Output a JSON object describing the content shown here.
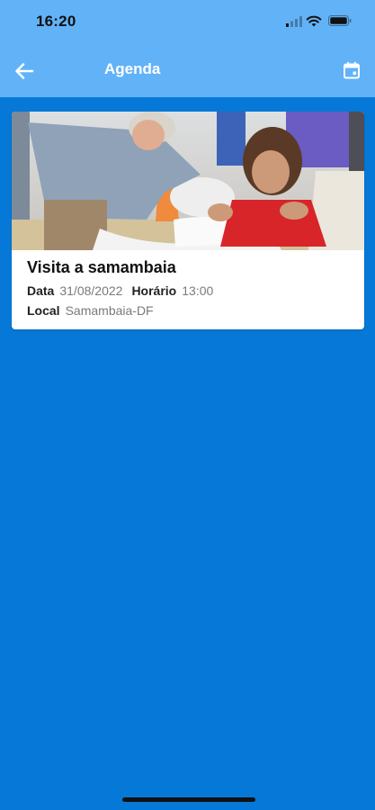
{
  "status_bar": {
    "time": "16:20"
  },
  "header": {
    "title": "Agenda",
    "back_icon": "arrow-left-icon",
    "calendar_icon": "calendar-icon",
    "background": "#62b2f7"
  },
  "events": [
    {
      "title": "Visita a samambaia",
      "date_label": "Data",
      "date": "31/08/2022",
      "time_label": "Horário",
      "time": "13:00",
      "location_label": "Local",
      "location": "Samambaia-DF"
    }
  ],
  "colors": {
    "page_background": "#0679d8",
    "card_background": "#ffffff",
    "value_text": "#7a7a7a"
  }
}
